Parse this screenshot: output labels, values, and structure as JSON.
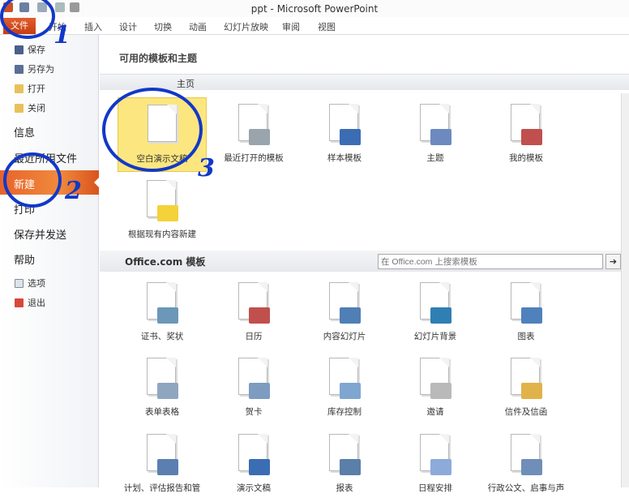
{
  "window": {
    "title": "ppt - Microsoft PowerPoint"
  },
  "ribbon": {
    "tabs": [
      "文件",
      "开始",
      "插入",
      "设计",
      "切换",
      "动画",
      "幻灯片放映",
      "审阅",
      "视图"
    ]
  },
  "backstage": {
    "items": [
      {
        "label": "保存",
        "type": "small"
      },
      {
        "label": "另存为",
        "type": "small"
      },
      {
        "label": "打开",
        "type": "small"
      },
      {
        "label": "关闭",
        "type": "small"
      },
      {
        "label": "信息",
        "type": "big"
      },
      {
        "label": "最近所用文件",
        "type": "big"
      },
      {
        "label": "新建",
        "type": "selected"
      },
      {
        "label": "打印",
        "type": "big"
      },
      {
        "label": "保存并发送",
        "type": "big"
      },
      {
        "label": "帮助",
        "type": "big"
      },
      {
        "label": "选项",
        "type": "small"
      },
      {
        "label": "退出",
        "type": "small"
      }
    ]
  },
  "main": {
    "heading": "可用的模板和主题",
    "nav_home": "主页",
    "templates": [
      {
        "label": "空白演示文稿",
        "icon": "blank-doc-icon",
        "color": "#ffffff"
      },
      {
        "label": "最近打开的模板",
        "icon": "clock-icon",
        "color": "#9aa4ad"
      },
      {
        "label": "样本模板",
        "icon": "monitor-icon",
        "color": "#3b6db5"
      },
      {
        "label": "主题",
        "icon": "theme-icon",
        "color": "#6c8ac0"
      },
      {
        "label": "我的模板",
        "icon": "person-icon",
        "color": "#c0504d"
      },
      {
        "label": "根据现有内容新建",
        "icon": "new-from-existing-icon",
        "color": "#f4d23a"
      }
    ],
    "office": {
      "heading": "Office.com 模板",
      "search_placeholder": "在 Office.com 上搜索模板",
      "search_button": "➔",
      "items": [
        {
          "label": "证书、奖状",
          "color": "#6c97b8"
        },
        {
          "label": "日历",
          "color": "#c0504d"
        },
        {
          "label": "内容幻灯片",
          "color": "#4f7fb5"
        },
        {
          "label": "幻灯片背景",
          "color": "#2f7fb3"
        },
        {
          "label": "图表",
          "color": "#4f81bd"
        },
        {
          "label": "表单表格",
          "color": "#8fa6c0"
        },
        {
          "label": "贺卡",
          "color": "#7d9cc0"
        },
        {
          "label": "库存控制",
          "color": "#7fa6d0"
        },
        {
          "label": "邀请",
          "color": "#b9b9b9"
        },
        {
          "label": "信件及信函",
          "color": "#e0b34a"
        },
        {
          "label": "计划、评估报告和管",
          "color": "#5b7fb0"
        },
        {
          "label": "演示文稿",
          "color": "#3b6db5"
        },
        {
          "label": "报表",
          "color": "#5a7fa8"
        },
        {
          "label": "日程安排",
          "color": "#8eaadb"
        },
        {
          "label": "行政公文、启事与声",
          "color": "#6f8fb8"
        }
      ]
    }
  },
  "annotations": [
    "1",
    "2",
    "3"
  ]
}
